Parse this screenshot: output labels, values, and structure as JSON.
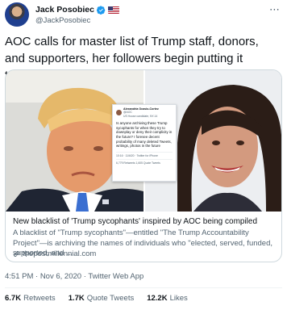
{
  "author": {
    "name": "Jack Posobiec",
    "handle": "@JackPosobiec",
    "avatar_icon": "profile-photo",
    "verified_color": "#1d9bf0"
  },
  "tweet": {
    "text": "AOC calls for master list of Trump staff, donors, and supporters, her followers begin putting it together"
  },
  "card": {
    "embedded_tweet": {
      "name": "Alexandria Ocasio-Cortez",
      "handle": "@AOC",
      "meta_top": "US House candidate, NY-14",
      "body": "Is anyone archiving these Trump sycophants for when they try to downplay or deny their complicity in the future? I foresee decent probability of many deleted Tweets, writings, photos in the future",
      "meta": "10:16 · 11/6/20 · Twitter for iPhone",
      "stats": "6,779 Retweets   1,605 Quote Tweets"
    },
    "title": "New blacklist of 'Trump sycophants' inspired by AOC being compiled",
    "description": "A blacklist of \"Trump sycophants\"—entitled \"The Trump Accountability Project\"—is archiving the names of individuals who \"elected, served, funded, supported, and ...",
    "domain": "thepostmillennial.com"
  },
  "timestamp": "4:51 PM · Nov 6, 2020 · Twitter Web App",
  "stats": {
    "retweets_count": "6.7K",
    "retweets_label": "Retweets",
    "quotes_count": "1.7K",
    "quotes_label": "Quote Tweets",
    "likes_count": "12.2K",
    "likes_label": "Likes"
  },
  "more_label": "⋯"
}
